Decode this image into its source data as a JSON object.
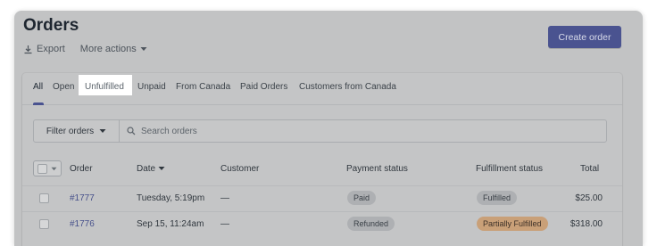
{
  "header": {
    "title": "Orders",
    "export_label": "Export",
    "more_actions_label": "More actions",
    "create_order_label": "Create order"
  },
  "tabs": [
    {
      "label": "All",
      "active": true
    },
    {
      "label": "Open"
    },
    {
      "label": "Unfulfilled",
      "highlighted": true
    },
    {
      "label": "Unpaid"
    },
    {
      "label": "From Canada"
    },
    {
      "label": "Paid Orders"
    },
    {
      "label": "Customers from Canada"
    }
  ],
  "filter": {
    "button_label": "Filter orders",
    "search_placeholder": "Search orders"
  },
  "table": {
    "columns": {
      "order": "Order",
      "date": "Date",
      "customer": "Customer",
      "payment_status": "Payment status",
      "fulfillment_status": "Fulfillment status",
      "total": "Total"
    },
    "rows": [
      {
        "order": "#1777",
        "date": "Tuesday, 5:19pm",
        "customer": "—",
        "payment_status": "Paid",
        "fulfillment_status": "Fulfilled",
        "total": "$25.00"
      },
      {
        "order": "#1776",
        "date": "Sep 15, 11:24am",
        "customer": "—",
        "payment_status": "Refunded",
        "fulfillment_status": "Partially Fulfilled",
        "total": "$318.00"
      }
    ]
  },
  "icons": {
    "export": "download-icon",
    "more_actions": "caret-down-icon",
    "filter": "caret-down-icon",
    "search": "search-icon",
    "date_sort": "caret-down-icon",
    "bulk_select": "caret-down-icon"
  },
  "colors": {
    "primary": "#4a5390",
    "badge_grey": "#aeb0b3",
    "badge_orange": "#c9a078"
  }
}
